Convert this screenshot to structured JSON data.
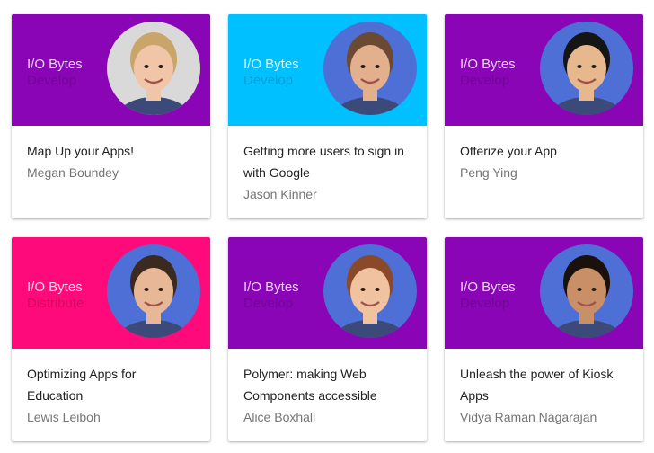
{
  "cards": [
    {
      "bytes": "I/O Bytes",
      "track": "Develop",
      "title": "Map Up your Apps!",
      "speaker": "Megan Boundey",
      "banner_color": "#8a05b5",
      "avatar_bg": "#d9d9d9",
      "skin": "#f1c5a8",
      "hair": "#c9a56a"
    },
    {
      "bytes": "I/O Bytes",
      "track": "Develop",
      "title": "Getting more users to sign in with Google",
      "speaker": "Jason Kinner",
      "banner_color": "#00c0ff",
      "avatar_bg": "#4d6fd6",
      "skin": "#e3b08e",
      "hair": "#6a4a33"
    },
    {
      "bytes": "I/O Bytes",
      "track": "Develop",
      "title": "Offerize your App",
      "speaker": "Peng Ying",
      "banner_color": "#8a05b5",
      "avatar_bg": "#4d6fd6",
      "skin": "#e7b88e",
      "hair": "#151515"
    },
    {
      "bytes": "I/O Bytes",
      "track": "Distribute",
      "title": "Optimizing Apps for Education",
      "speaker": "Lewis Leiboh",
      "banner_color": "#ff0a7a",
      "avatar_bg": "#4d6fd6",
      "skin": "#e8b896",
      "hair": "#3a2a20"
    },
    {
      "bytes": "I/O Bytes",
      "track": "Develop",
      "title": "Polymer: making Web Components accessible",
      "speaker": "Alice Boxhall",
      "banner_color": "#8a05b5",
      "avatar_bg": "#4d6fd6",
      "skin": "#f0c2a0",
      "hair": "#8a4a2a"
    },
    {
      "bytes": "I/O Bytes",
      "track": "Develop",
      "title": "Unleash the power of Kiosk Apps",
      "speaker": "Vidya Raman Nagarajan",
      "banner_color": "#8a05b5",
      "avatar_bg": "#4d6fd6",
      "skin": "#c98f66",
      "hair": "#1a110c"
    }
  ]
}
